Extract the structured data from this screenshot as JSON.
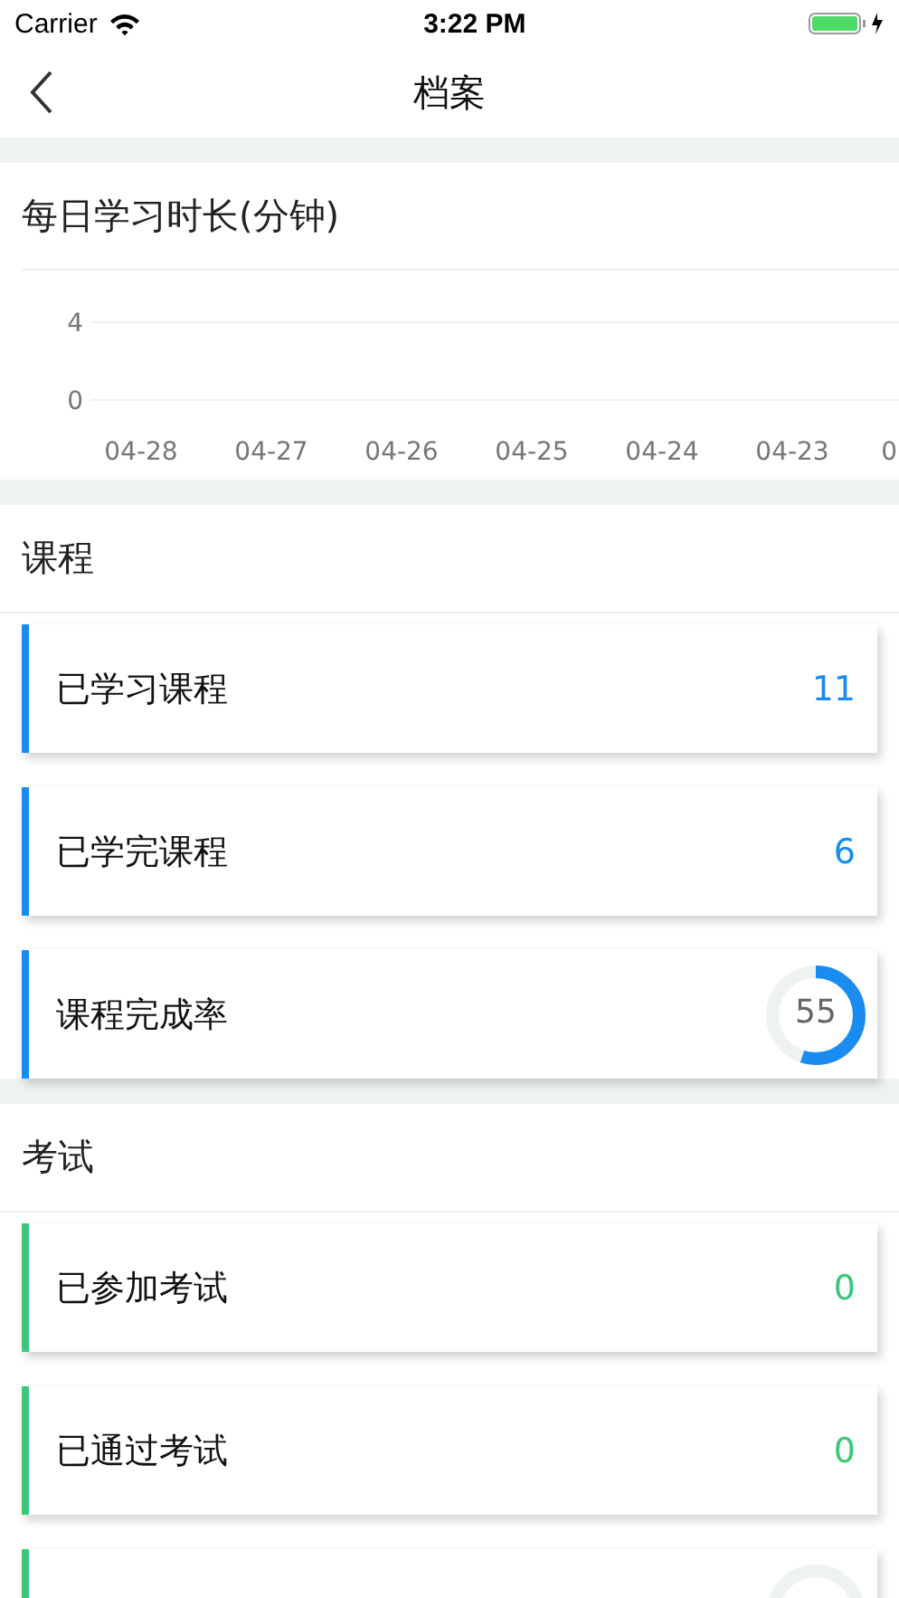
{
  "status_bar": {
    "carrier": "Carrier",
    "time": "3:22 PM"
  },
  "nav": {
    "title": "档案"
  },
  "chart_section": {
    "title": "每日学习时长(分钟)",
    "chart_data": {
      "type": "line",
      "categories": [
        "04-28",
        "04-27",
        "04-26",
        "04-25",
        "04-24",
        "04-23",
        "0"
      ],
      "yticks": [
        0,
        4
      ],
      "ylim": [
        0,
        4
      ]
    }
  },
  "sections": [
    {
      "title": "课程",
      "color": "#1a8cf0",
      "cards": [
        {
          "kind": "count",
          "label": "已学习课程",
          "value": "11"
        },
        {
          "kind": "count",
          "label": "已学完课程",
          "value": "6"
        },
        {
          "kind": "ring",
          "label": "课程完成率",
          "value": "55",
          "level": 0.55
        }
      ]
    },
    {
      "title": "考试",
      "color": "#3cc878",
      "cards": [
        {
          "kind": "count",
          "label": "已参加考试",
          "value": "0"
        },
        {
          "kind": "count",
          "label": "已通过考试",
          "value": "0"
        },
        {
          "kind": "ring"
        }
      ]
    }
  ]
}
